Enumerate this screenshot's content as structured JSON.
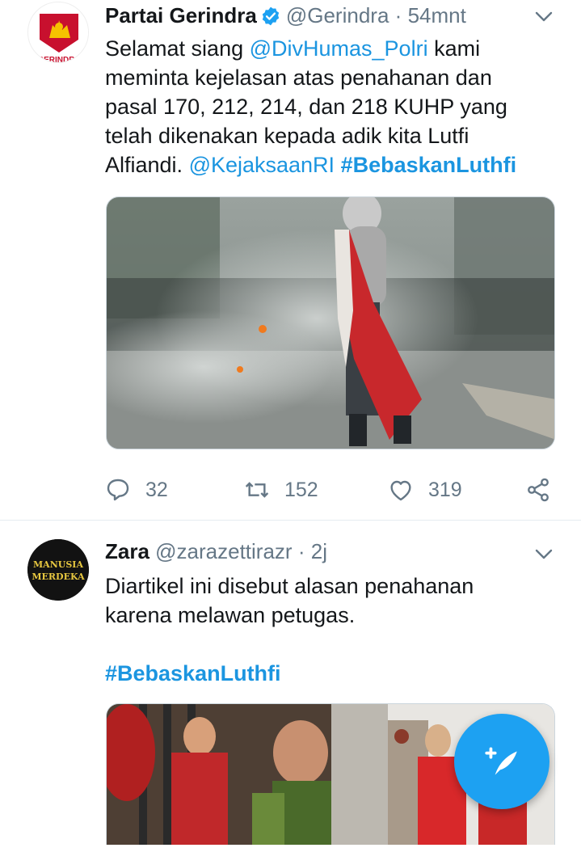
{
  "tweet1": {
    "author_name": "Partai Gerindra",
    "handle": "@Gerindra",
    "separator": "·",
    "time": "54mnt",
    "avatar_text": "GERINDRA",
    "text_pre": "Selamat siang ",
    "mention1": "@DivHumas_Polri",
    "text_mid": " kami meminta kejelasan atas penahanan dan pasal 170, 212, 214, dan 218 KUHP yang telah dikenakan kepada adik kita Lutfi Alfiandi. ",
    "mention2": "@KejaksaanRI",
    "space": " ",
    "hashtag": "#BebaskanLuthfi",
    "replies": "32",
    "retweets": "152",
    "likes": "319"
  },
  "tweet2": {
    "author_name": "Zara",
    "handle": "@zarazettirazr",
    "separator": "·",
    "time": "2j",
    "avatar_line1": "MANUSIA",
    "avatar_line2": "MERDEKA",
    "text": "Diartikel ini disebut alasan penahanan karena melawan petugas.",
    "hashtag": "#BebaskanLuthfi"
  },
  "colors": {
    "link": "#1b95e0",
    "secondary": "#657786",
    "fab": "#1da1f2"
  },
  "icons": [
    "verified-badge-icon",
    "chevron-down-icon",
    "reply-icon",
    "retweet-icon",
    "like-icon",
    "share-icon",
    "compose-tweet-icon"
  ]
}
